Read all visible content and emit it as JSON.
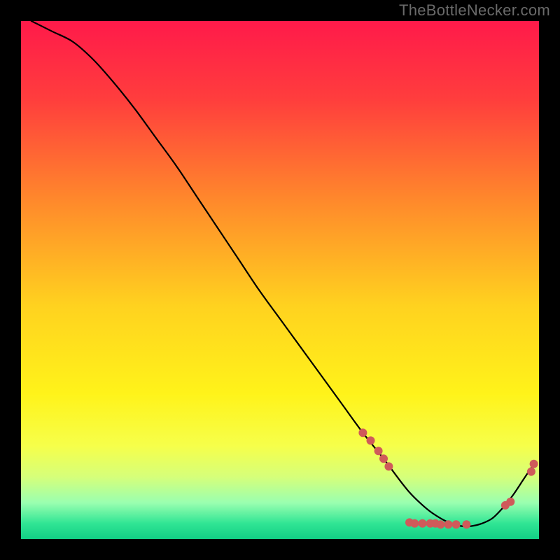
{
  "watermark": "TheBottleNecker.com",
  "gradient": {
    "stops": [
      {
        "offset": 0.0,
        "color": "#ff1a4a"
      },
      {
        "offset": 0.15,
        "color": "#ff3d3d"
      },
      {
        "offset": 0.35,
        "color": "#ff8a2b"
      },
      {
        "offset": 0.55,
        "color": "#ffd21f"
      },
      {
        "offset": 0.72,
        "color": "#fff31a"
      },
      {
        "offset": 0.82,
        "color": "#f6ff4a"
      },
      {
        "offset": 0.88,
        "color": "#d6ff7a"
      },
      {
        "offset": 0.93,
        "color": "#9affb0"
      },
      {
        "offset": 0.97,
        "color": "#30e594"
      },
      {
        "offset": 1.0,
        "color": "#12cf85"
      }
    ]
  },
  "chart_data": {
    "type": "line",
    "title": "",
    "xlabel": "",
    "ylabel": "",
    "xlim": [
      0,
      100
    ],
    "ylim": [
      0,
      100
    ],
    "series": [
      {
        "name": "curve",
        "x": [
          2,
          6,
          10,
          14,
          18,
          22,
          26,
          30,
          34,
          38,
          42,
          46,
          50,
          54,
          58,
          62,
          66,
          70,
          73,
          75,
          77,
          79,
          81,
          83,
          85,
          87,
          89,
          91,
          93,
          95,
          97,
          99
        ],
        "values": [
          100,
          98,
          96,
          92.5,
          88,
          83,
          77.5,
          72,
          66,
          60,
          54,
          48,
          42.5,
          37,
          31.5,
          26,
          20.5,
          15.5,
          11.5,
          9,
          7,
          5.3,
          4,
          3,
          2.5,
          2.5,
          3,
          4,
          6,
          8.5,
          11.5,
          14.5
        ]
      },
      {
        "name": "markers",
        "x": [
          66,
          67.5,
          69,
          70,
          71,
          75,
          76,
          77.5,
          79,
          80,
          81,
          82.5,
          84,
          86,
          93.5,
          94.5,
          98.5,
          99
        ],
        "values": [
          20.5,
          19,
          17,
          15.5,
          14,
          3.2,
          3,
          3,
          3,
          3,
          2.8,
          2.8,
          2.8,
          2.8,
          6.5,
          7.2,
          13,
          14.5
        ]
      }
    ]
  }
}
